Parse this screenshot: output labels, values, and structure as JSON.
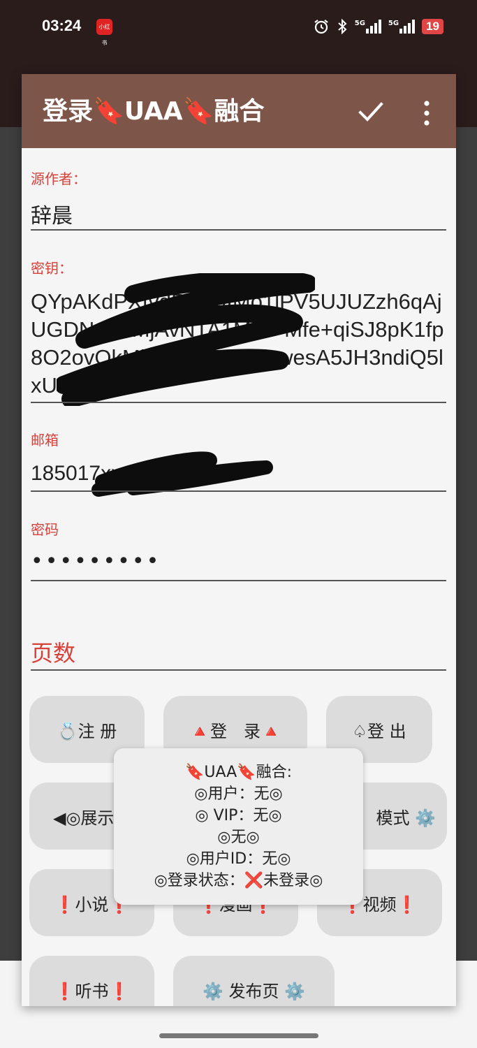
{
  "status_bar": {
    "time": "03:24",
    "app_icon_text": "小红书",
    "signal_1": "5G",
    "signal_2": "5G",
    "battery": "19"
  },
  "dialog": {
    "title": "登录🔖UAA🔖融合",
    "fields": {
      "author": {
        "label": "源作者：",
        "value": "辞晨"
      },
      "key": {
        "label": "密钥：",
        "value": "QYpAKdPXfvdRiJbuIMo1lPV5UJUZzh6qAjUGDNgZaMjAvNTA1MjU=Mfe+qiSJ8pK1fp8O2ovOkMkUyHQ70MZowesA5JH3ndiQ5lxUHXQ"
      },
      "email": {
        "label": "邮箱",
        "value": "185017xxxx@qq.com"
      },
      "password": {
        "label": "密码",
        "value": "•••••••••"
      },
      "pages": {
        "label": "页数"
      }
    },
    "buttons": {
      "register": "💍注 册",
      "login": "🔺登　录🔺",
      "logout": "♤登 出",
      "display": "◀◎展示",
      "mode": "模式 ⚙️",
      "novel": "❗小说❗",
      "comic": "❗漫画❗",
      "video": "❗视频❗",
      "audiobook": "❗听书❗",
      "publish": "⚙️ 发布页 ⚙️"
    }
  },
  "toast": {
    "lines": [
      "🔖UAA🔖融合:",
      "◎用户：无◎",
      "◎ VIP：无◎",
      "◎无◎",
      "◎用户ID：无◎",
      "◎登录状态：❌未登录◎"
    ]
  },
  "colors": {
    "toolbar": "#7d5649",
    "label_red": "#d8403a",
    "dialog_bg": "#f5f5f5",
    "button_bg": "#dcdcdc",
    "status_bg": "#2b1c1c"
  }
}
